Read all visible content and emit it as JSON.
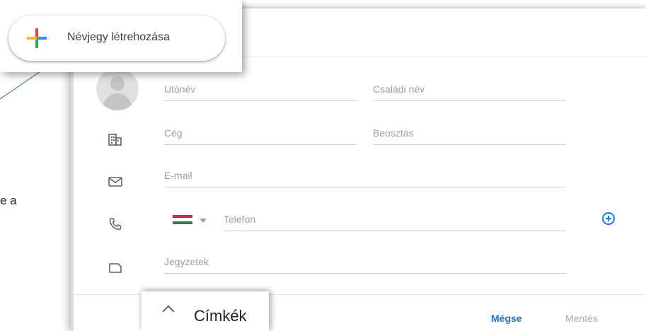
{
  "background": {
    "partial_text": "e a"
  },
  "create_contact": {
    "label": "Névjegy létrehozása"
  },
  "form": {
    "first_name_placeholder": "Utónév",
    "last_name_placeholder": "Családi név",
    "company_placeholder": "Cég",
    "job_title_placeholder": "Beosztás",
    "email_placeholder": "E-mail",
    "phone_placeholder": "Telefon",
    "notes_placeholder": "Jegyzetek"
  },
  "footer": {
    "cancel_label": "Mégse",
    "save_label": "Mentés"
  },
  "labels_panel": {
    "title": "Címkék"
  },
  "colors": {
    "accent": "#1a73e8",
    "flag_red": "#cd2a3e",
    "flag_white": "#ffffff",
    "flag_green": "#436f4d"
  },
  "icons": {
    "company": "building-icon",
    "email": "mail-icon",
    "phone": "phone-icon",
    "notes": "notes-icon",
    "add": "add-circle-icon",
    "collapse": "chevron-up-icon",
    "create": "plus-icon"
  }
}
